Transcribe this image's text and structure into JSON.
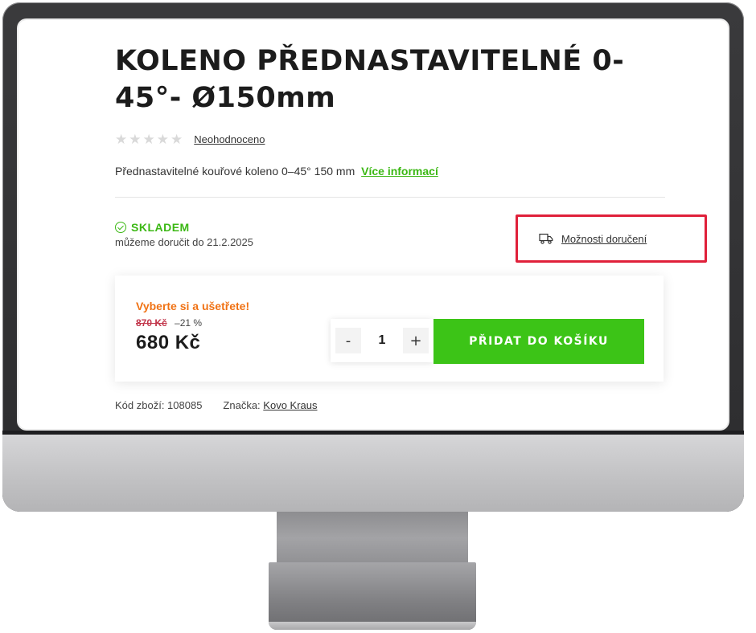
{
  "product": {
    "title": "KOLENO PŘEDNASTAVITELNÉ 0-45°- Ø150mm",
    "rating_label": "Neohodnoceno",
    "rating_stars": 0,
    "description": "Přednastavitelné kouřové koleno 0–45° 150 mm",
    "more_info_label": "Více informací"
  },
  "stock": {
    "status": "SKLADEM",
    "delivery_date_text": "můžeme doručit do 21.2.2025",
    "delivery_options_label": "Možnosti doručení"
  },
  "pricing": {
    "promo_text": "Vyberte si a ušetřete!",
    "old_price": "870 Kč",
    "discount": "–21 %",
    "price": "680 Kč"
  },
  "cart": {
    "minus_label": "-",
    "quantity": "1",
    "plus_label": "+",
    "add_button_label": "PŘIDAT DO KOŠÍKU"
  },
  "meta": {
    "code_text": "Kód zboží: 108085",
    "brand_prefix": "Značka:",
    "brand_name": "Kovo Kraus"
  },
  "colors": {
    "accent_green": "#3cc417",
    "promo_orange": "#f07214",
    "highlight_red": "#e0203a"
  }
}
